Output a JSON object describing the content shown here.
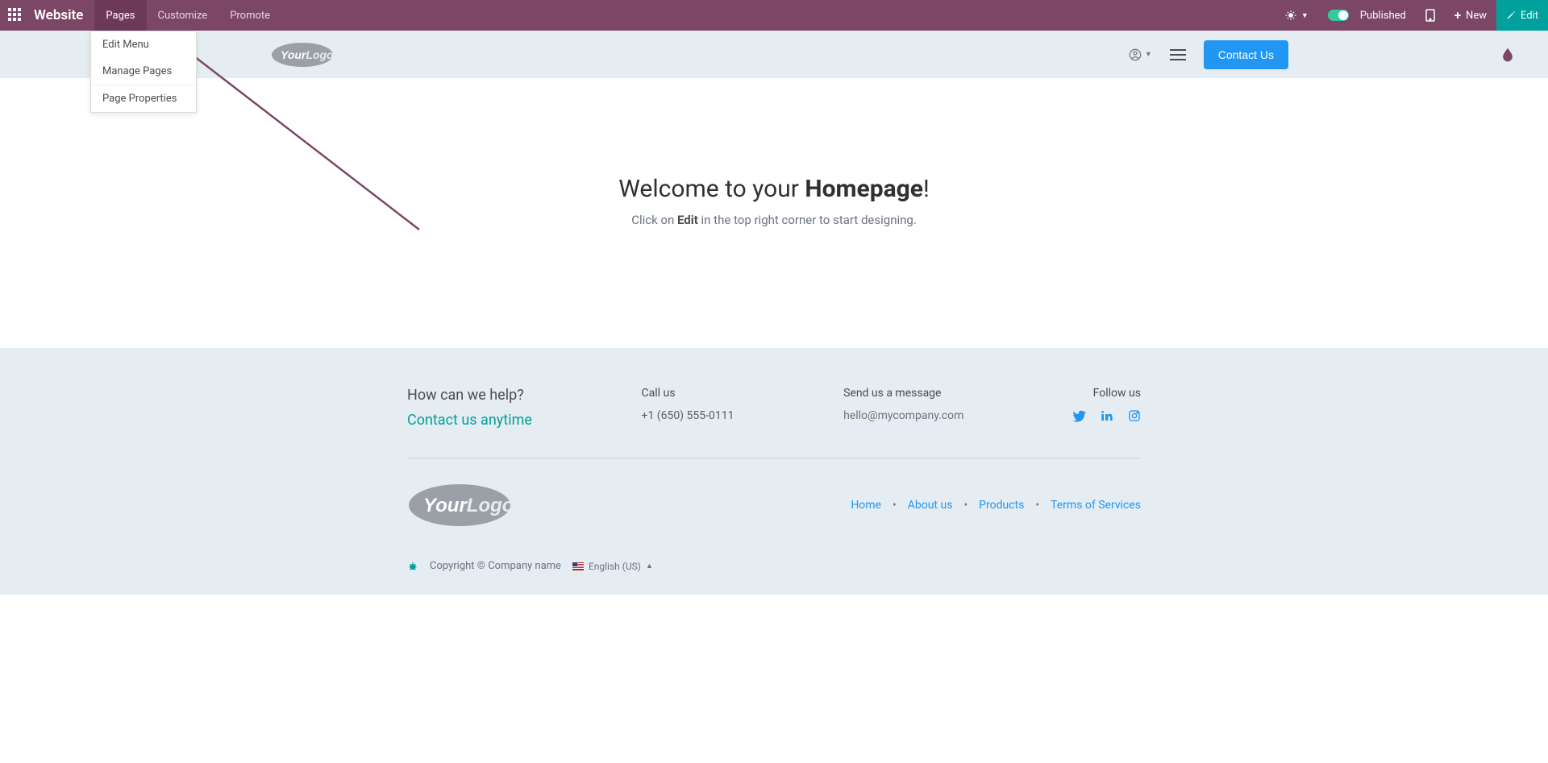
{
  "topbar": {
    "brand": "Website",
    "menu": [
      "Pages",
      "Customize",
      "Promote"
    ],
    "published_label": "Published",
    "new_label": "New",
    "edit_label": "Edit"
  },
  "pages_dropdown": {
    "items": [
      "Edit Menu",
      "Manage Pages"
    ],
    "separated": [
      "Page Properties"
    ]
  },
  "subheader": {
    "logo_text_1": "Your",
    "logo_text_2": "Logo",
    "contact_label": "Contact Us"
  },
  "main": {
    "welcome_pre": "Welcome to your ",
    "welcome_bold": "Homepage",
    "welcome_post": "!",
    "sub_pre": "Click on ",
    "sub_bold": "Edit",
    "sub_post": " in the top right corner to start designing."
  },
  "footer": {
    "help_title": "How can we help?",
    "help_link": "Contact us anytime",
    "call_title": "Call us",
    "call_value": "+1 (650) 555-0111",
    "msg_title": "Send us a message",
    "msg_value": "hello@mycompany.com",
    "follow_title": "Follow us",
    "links": [
      "Home",
      "About us",
      "Products",
      "Terms of Services"
    ],
    "copyright": "Copyright © Company name",
    "language": "English (US)"
  }
}
